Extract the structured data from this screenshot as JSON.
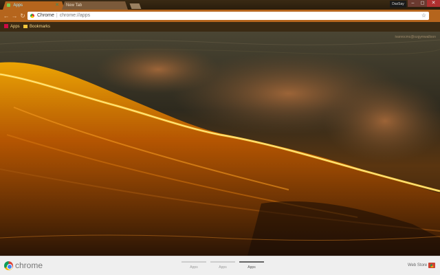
{
  "tabs": [
    {
      "label": "Apps",
      "active": true
    },
    {
      "label": "New Tab",
      "active": false
    }
  ],
  "window": {
    "profile_label": "DaxSay",
    "min_glyph": "–",
    "max_glyph": "◻",
    "close_glyph": "✕"
  },
  "toolbar": {
    "back_glyph": "←",
    "forward_glyph": "→",
    "reload_glyph": "↻",
    "omnibox_site": "Chrome",
    "omnibox_sep": "|",
    "omnibox_url": "chrome://apps",
    "star_glyph": "☆"
  },
  "bookmarks": {
    "apps_label": "Apps",
    "bookmarks_label": "Bookmarks"
  },
  "content": {
    "credit": "ivanrocmc@ozgymwalloon"
  },
  "bottom": {
    "brand": "chrome",
    "pages": [
      {
        "label": "Apps",
        "active": false
      },
      {
        "label": "Apps",
        "active": false
      },
      {
        "label": "Apps",
        "active": true
      }
    ],
    "webstore_label": "Web Store"
  },
  "colors": {
    "theme_accent": "#b5651d",
    "wave_glow": "#ffb000"
  }
}
